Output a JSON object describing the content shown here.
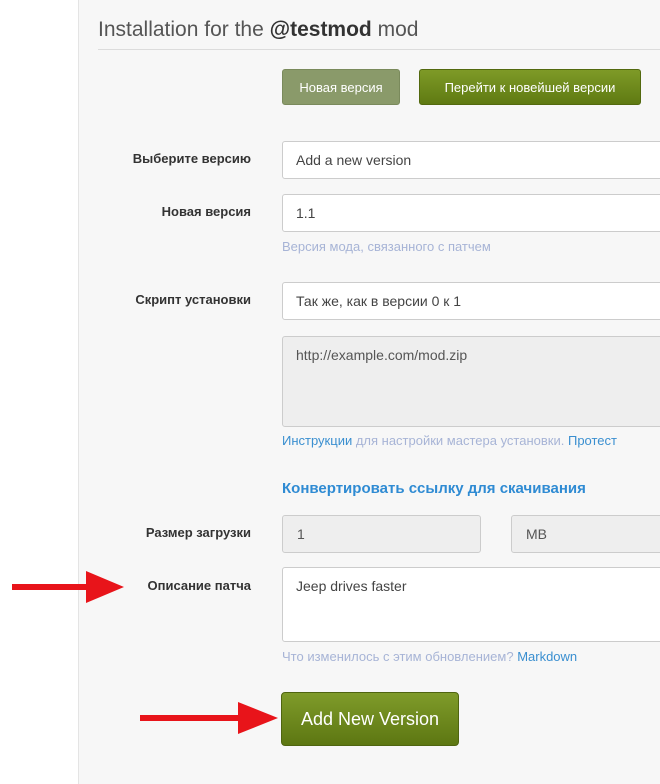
{
  "header": {
    "title_prefix": "Installation for the ",
    "mod_name": "@testmod",
    "title_suffix": " mod"
  },
  "actions": {
    "new_version_label": "Новая версия",
    "goto_latest_label": "Перейти к новейшей версии"
  },
  "form": {
    "select_version": {
      "label": "Выберите версию",
      "value": "Add a new version"
    },
    "new_version": {
      "label": "Новая версия",
      "value": "1.1",
      "help": "Версия мода, связанного с патчем"
    },
    "install_script": {
      "label": "Скрипт установки",
      "value": "Так же, как в версии 0 к 1",
      "script_text": "http://example.com/mod.zip",
      "help_link": "Инструкции",
      "help_text": " для настройки мастера установки. ",
      "help_link2": "Протест"
    },
    "convert_link": "Конвертировать ссылку для скачивания",
    "download_size": {
      "label": "Размер загрузки",
      "value": "1",
      "unit": "MB"
    },
    "patch_notes": {
      "label": "Описание патча",
      "value": "Jeep drives faster",
      "help": "Что изменилось с этим обновлением? ",
      "help_link": "Markdown"
    },
    "submit_label": "Add New Version"
  },
  "annotations": {
    "arrow_color": "#e8141a"
  }
}
